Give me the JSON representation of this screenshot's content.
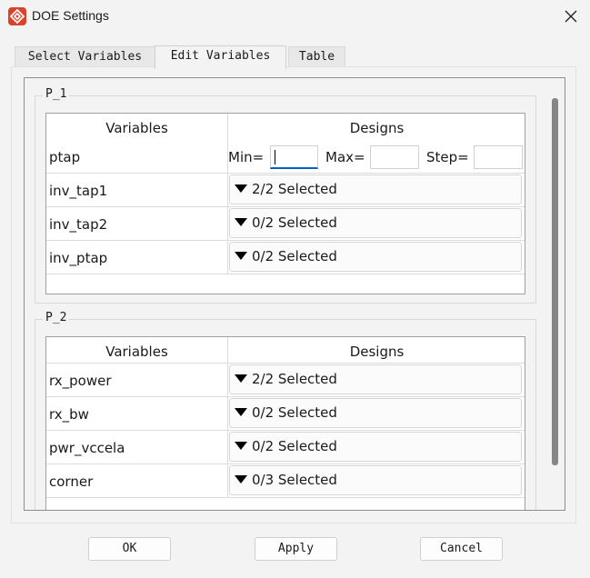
{
  "window": {
    "title": "DOE Settings",
    "accent_color": "#d9432a"
  },
  "tabs": [
    {
      "label": "Select Variables",
      "active": false
    },
    {
      "label": "Edit Variables",
      "active": true
    },
    {
      "label": "Table",
      "active": false
    }
  ],
  "groups": [
    {
      "title": "P_1",
      "header": {
        "variables": "Variables",
        "designs": "Designs"
      },
      "range_row": {
        "name": "ptap",
        "min_label": "Min=",
        "max_label": "Max=",
        "step_label": "Step=",
        "min_value": "",
        "max_value": "",
        "step_value": ""
      },
      "rows": [
        {
          "name": "inv_tap1",
          "selection": "2/2 Selected"
        },
        {
          "name": "inv_tap2",
          "selection": "0/2 Selected"
        },
        {
          "name": "inv_ptap",
          "selection": "0/2 Selected"
        }
      ]
    },
    {
      "title": "P_2",
      "header": {
        "variables": "Variables",
        "designs": "Designs"
      },
      "rows": [
        {
          "name": "rx_power",
          "selection": "2/2 Selected"
        },
        {
          "name": "rx_bw",
          "selection": "0/2 Selected"
        },
        {
          "name": "pwr_vccela",
          "selection": "0/2 Selected"
        },
        {
          "name": "corner",
          "selection": "0/3 Selected"
        }
      ]
    }
  ],
  "buttons": {
    "ok": "OK",
    "apply": "Apply",
    "cancel": "Cancel"
  }
}
